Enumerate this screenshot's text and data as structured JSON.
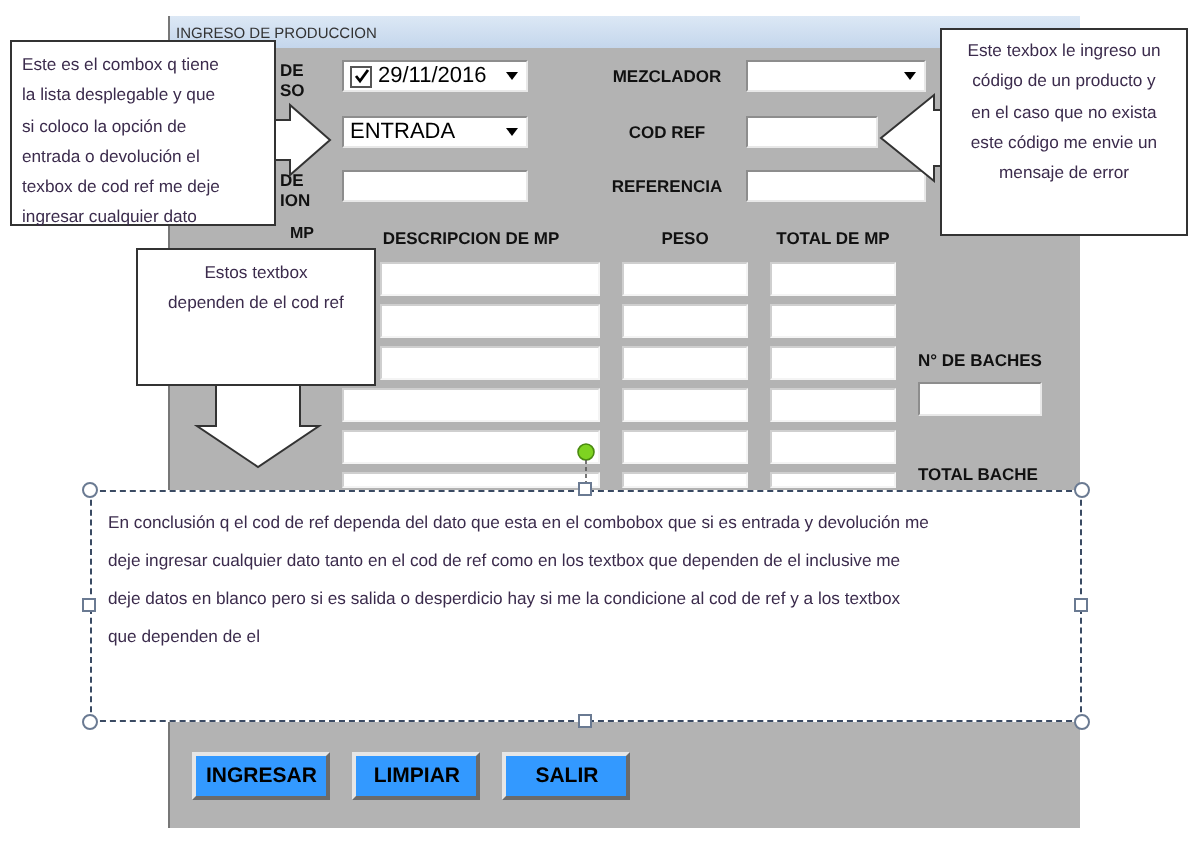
{
  "window": {
    "title": "INGRESO DE PRODUCCION"
  },
  "left_fields": [
    {
      "kind": "date",
      "checked": true,
      "value": "29/11/2016",
      "label_lines": "DE\nSO"
    },
    {
      "kind": "combo",
      "value": "ENTRADA"
    },
    {
      "kind": "text",
      "label_lines": "DE\nION"
    }
  ],
  "right_fields": [
    {
      "label": "MEZCLADOR",
      "kind": "combo"
    },
    {
      "label": "COD REF",
      "kind": "text"
    },
    {
      "label": "REFERENCIA",
      "kind": "text"
    }
  ],
  "table": {
    "columns": [
      "MP",
      "DESCRIPCION DE MP",
      "PESO",
      "TOTAL DE MP"
    ]
  },
  "batches": {
    "label": "N° DE BACHES"
  },
  "total": {
    "label": "TOTAL BACHE"
  },
  "buttons": [
    "INGRESAR",
    "LIMPIAR",
    "SALIR"
  ],
  "callouts": [
    {
      "kind": "pointing-right",
      "text": "Este es el combox q tiene\nla lista desplegable y que\nsi coloco la opción de\nentrada o devolución el\ntexbox de cod ref me deje\ningresar cualquier dato"
    },
    {
      "kind": "pointing-left",
      "text": "Este texbox le ingreso un\ncódigo de un producto y\nen el caso que no exista\neste código me envie un\nmensaje de error"
    },
    {
      "kind": "pointing-down",
      "text": "Estos textbox\ndependen de el cod ref"
    }
  ],
  "note": {
    "text": "En conclusión q el cod de ref dependa del dato que esta en el combobox que si es entrada y devolución me\ndeje ingresar cualquier dato tanto en el cod de ref como en los textbox que dependen de el inclusive me\ndeje datos en blanco pero si es salida o desperdicio hay si me la condicione al cod de ref y a los textbox\nque dependen de el"
  }
}
